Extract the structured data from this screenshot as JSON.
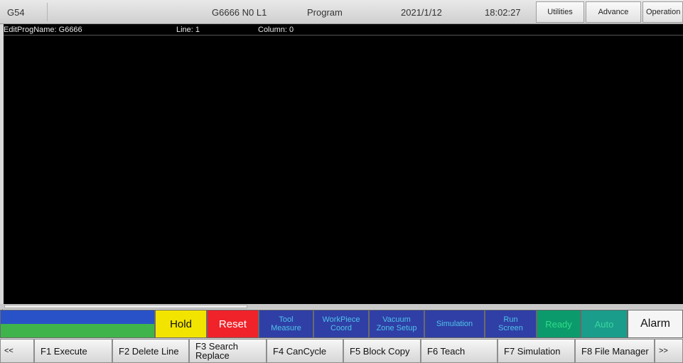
{
  "top_bar": {
    "coordinate_system": "G54",
    "program_position": "G6666 N0 L1",
    "mode": "Program",
    "date": "2021/1/12",
    "time": "18:02:27",
    "utilities_label": "Utilities",
    "advance_label": "Advance",
    "operation_label": "Operation"
  },
  "info_line": {
    "edit_prog_name": "EditProgName: G6666",
    "line": "Line: 1",
    "column": "Column: 0"
  },
  "control_row": {
    "hold_label": "Hold",
    "reset_label": "Reset",
    "tool_measure": [
      "Tool",
      "Measure"
    ],
    "workpiece_coord": [
      "WorkPiece",
      "Coord"
    ],
    "vacuum_zone_setup": [
      "Vacuum",
      "Zone Setup"
    ],
    "simulation_label": "Simulation",
    "run_screen": [
      "Run",
      "Screen"
    ],
    "ready_label": "Ready",
    "auto_label": "Auto",
    "alarm_label": "Alarm"
  },
  "function_keys": {
    "prev_label": "<<",
    "f1": "F1 Execute",
    "f2": "F2 Delete Line",
    "f3": [
      "F3 Search",
      "Replace"
    ],
    "f4": "F4 CanCycle",
    "f5": "F5 Block Copy",
    "f6": "F6 Teach",
    "f7": "F7 Simulation",
    "f8": "F8 File Manager",
    "next_label": ">>"
  },
  "colors": {
    "hold": "#f3e400",
    "reset": "#f0232a",
    "blue_button": "#2f3fa6",
    "blue_text": "#4fc3e8",
    "ready": "#0b9a6b",
    "auto": "#1a9d8a",
    "progress_blue": "#2952c8",
    "progress_green": "#3fb44a"
  },
  "icons": {
    "scroll_left": "scroll-left-arrow-icon"
  }
}
